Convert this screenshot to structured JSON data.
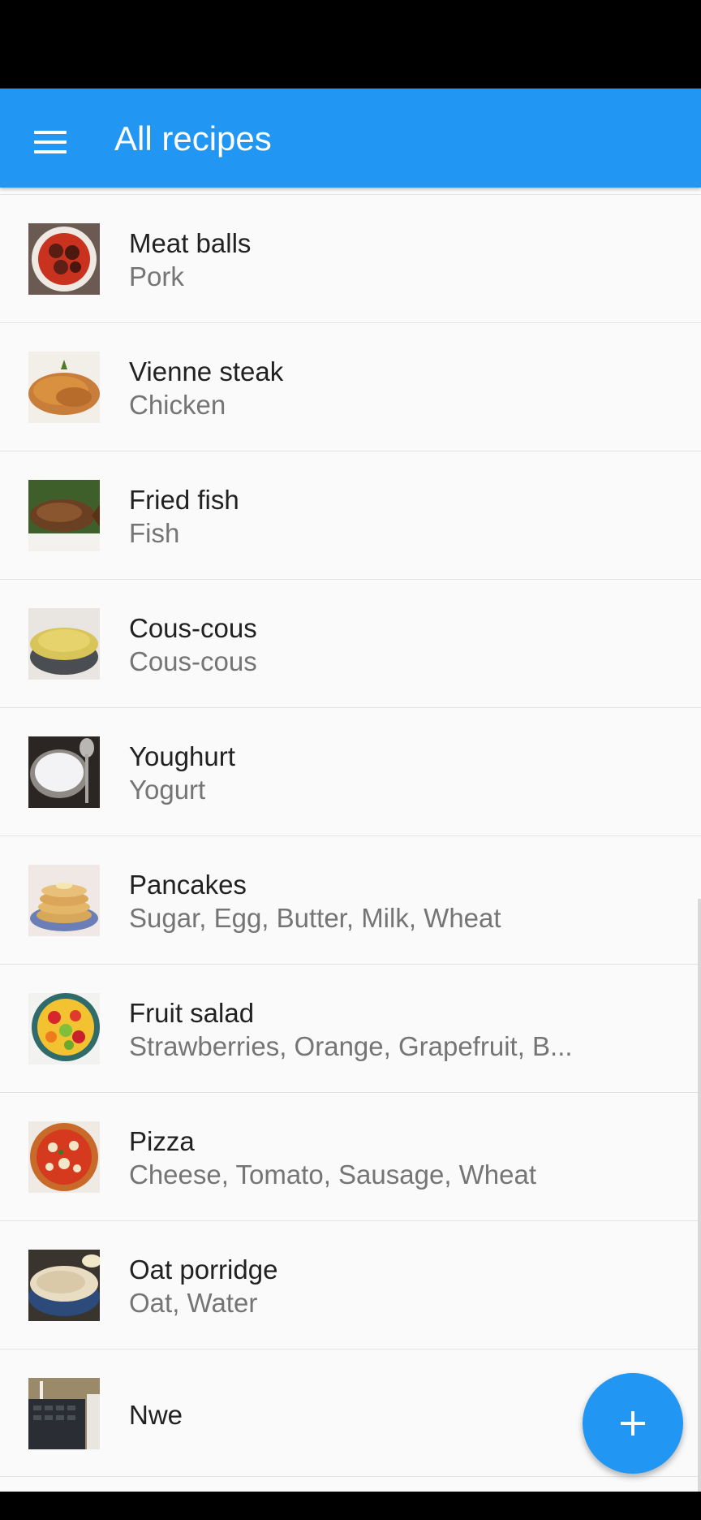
{
  "app_bar": {
    "title": "All recipes",
    "menu_icon": "menu-icon",
    "color": "#2196F3"
  },
  "recipes": [
    {
      "title": "Meat balls",
      "ingredients": "Pork",
      "thumb": "meat-balls-thumbnail"
    },
    {
      "title": "Vienne steak",
      "ingredients": "Chicken",
      "thumb": "vienne-steak-thumbnail"
    },
    {
      "title": "Fried fish",
      "ingredients": "Fish",
      "thumb": "fried-fish-thumbnail"
    },
    {
      "title": "Cous-cous",
      "ingredients": "Cous-cous",
      "thumb": "cous-cous-thumbnail"
    },
    {
      "title": "Youghurt",
      "ingredients": "Yogurt",
      "thumb": "youghurt-thumbnail"
    },
    {
      "title": "Pancakes",
      "ingredients": "Sugar, Egg, Butter, Milk, Wheat",
      "thumb": "pancakes-thumbnail"
    },
    {
      "title": "Fruit salad",
      "ingredients": "Strawberries, Orange, Grapefruit, B...",
      "thumb": "fruit-salad-thumbnail"
    },
    {
      "title": "Pizza",
      "ingredients": "Cheese, Tomato, Sausage, Wheat",
      "thumb": "pizza-thumbnail"
    },
    {
      "title": "Oat porridge",
      "ingredients": "Oat, Water",
      "thumb": "oat-porridge-thumbnail"
    },
    {
      "title": "Nwe",
      "ingredients": "",
      "thumb": "nwe-thumbnail"
    }
  ],
  "fab": {
    "icon": "plus-icon",
    "color": "#2196F3"
  }
}
